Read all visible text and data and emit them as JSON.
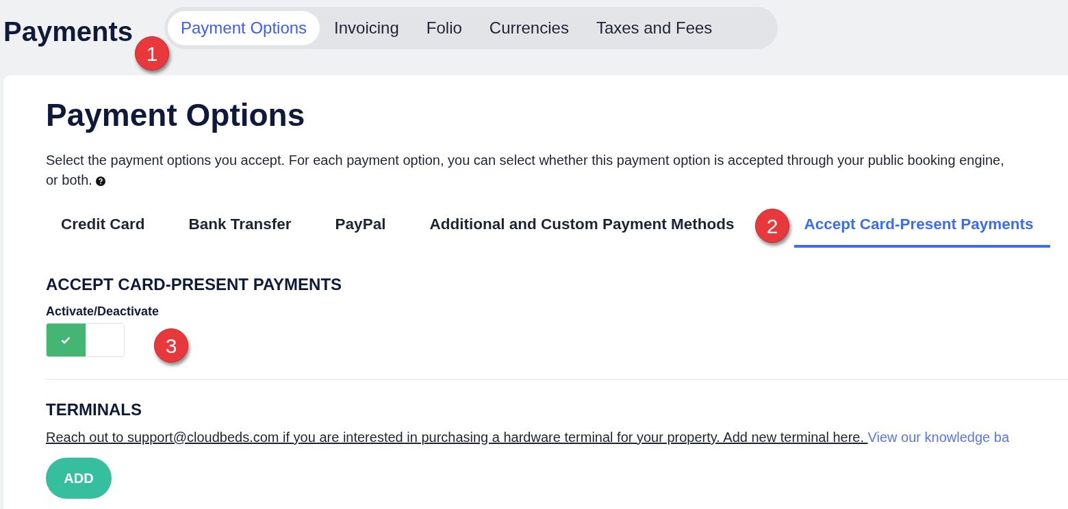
{
  "header": {
    "title": "Payments",
    "tabs": [
      {
        "label": "Payment Options",
        "selected": true
      },
      {
        "label": "Invoicing",
        "selected": false
      },
      {
        "label": "Folio",
        "selected": false
      },
      {
        "label": "Currencies",
        "selected": false
      },
      {
        "label": "Taxes and Fees",
        "selected": false
      }
    ]
  },
  "page": {
    "title": "Payment Options",
    "description_lines": [
      "Select the payment options you accept. For each payment option, you can select whether this payment option is accepted through your public booking engine,",
      "or both."
    ],
    "method_tabs": [
      {
        "label": "Credit Card",
        "selected": false
      },
      {
        "label": "Bank Transfer",
        "selected": false
      },
      {
        "label": "PayPal",
        "selected": false
      },
      {
        "label": "Additional and Custom Payment Methods",
        "selected": false
      },
      {
        "label": "Accept Card-Present Payments",
        "selected": true
      }
    ]
  },
  "card_present": {
    "heading": "ACCEPT CARD-PRESENT PAYMENTS",
    "toggle_label": "Activate/Deactivate",
    "on": true
  },
  "terminals": {
    "heading": "TERMINALS",
    "info_link": "Reach out to support@cloudbeds.com if you are interested in purchasing a hardware terminal for your property. Add new terminal here. ",
    "kb_link": "View our knowledge ba",
    "add_button": "ADD"
  },
  "callouts": [
    "1",
    "2",
    "3"
  ]
}
